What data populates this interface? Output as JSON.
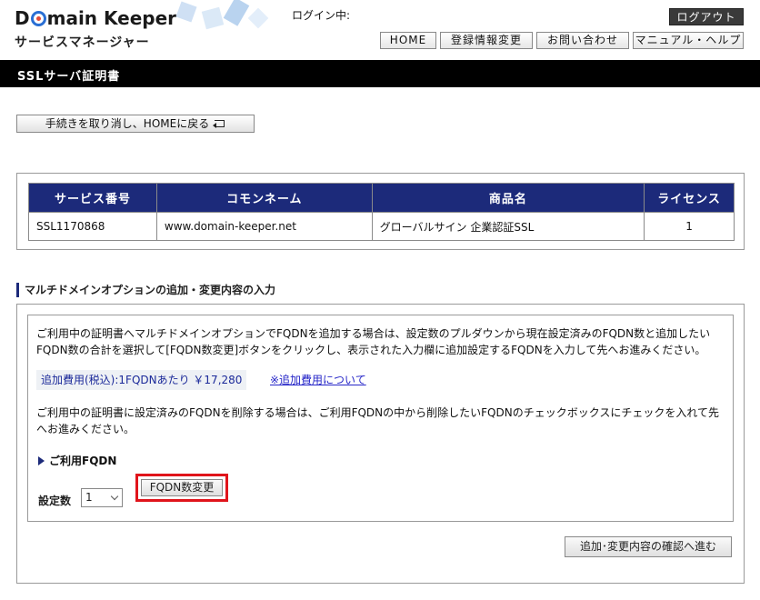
{
  "header": {
    "logo_main_pre": "D",
    "logo_main_post": "main Keeper",
    "logo_sub": "サービスマネージャー",
    "login_status": "ログイン中:",
    "logout_label": "ログアウト",
    "nav": [
      "HOME",
      "登録情報変更",
      "お問い合わせ",
      "マニュアル・ヘルプ"
    ]
  },
  "page_title": "SSLサーバ証明書",
  "cancel_home_label": "手続きを取り消し、HOMEに戻る",
  "service_table": {
    "headers": [
      "サービス番号",
      "コモンネーム",
      "商品名",
      "ライセンス"
    ],
    "row": [
      "SSL1170868",
      "www.domain-keeper.net",
      "グローバルサイン 企業認証SSL",
      "1"
    ]
  },
  "section": {
    "heading": "マルチドメインオプションの追加・変更内容の入力",
    "para1": "ご利用中の証明書へマルチドメインオプションでFQDNを追加する場合は、設定数のプルダウンから現在設定済みのFQDN数と追加したいFQDN数の合計を選択して[FQDN数変更]ボタンをクリックし、表示された入力欄に追加設定するFQDNを入力して先へお進みください。",
    "fee_text": "追加費用(税込):1FQDNあたり ￥17,280",
    "fee_link": "※追加費用について",
    "para2": "ご利用中の証明書に設定済みのFQDNを削除する場合は、ご利用FQDNの中から削除したいFQDNのチェックボックスにチェックを入れて先へお進みください。",
    "fqdn_toggle": "ご利用FQDN",
    "count_label": "設定数",
    "count_value": "1",
    "fqdn_change_label": "FQDN数変更",
    "confirm_label": "追加･変更内容の確認へ進む"
  },
  "colors": {
    "table_header": "#1c2a7a",
    "highlight_border": "#e0141b",
    "title_bar": "#000000",
    "link": "#2626c8"
  }
}
